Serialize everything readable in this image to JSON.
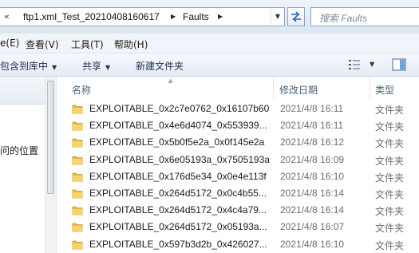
{
  "address_bar": {
    "overflow_chevron": "«",
    "crumbs": [
      "ftp1.xml_Test_20210408160617",
      "Faults"
    ]
  },
  "search": {
    "placeholder": "搜索 Faults"
  },
  "menu": {
    "items": [
      "e(E)",
      "查看(V)",
      "工具(T)",
      "帮助(H)"
    ]
  },
  "toolbar": {
    "include_in_library": "包含到库中",
    "share": "共享",
    "new_folder": "新建文件夹"
  },
  "nav_pane": {
    "visible_text": "问的位置"
  },
  "columns": {
    "name": "名称",
    "date": "修改日期",
    "type": "类型"
  },
  "files": [
    {
      "name": "EXPLOITABLE_0x2c7e0762_0x16107b60",
      "date": "2021/4/8 16:11",
      "type": "文件夹"
    },
    {
      "name": "EXPLOITABLE_0x4e6d4074_0x553939...",
      "date": "2021/4/8 16:11",
      "type": "文件夹"
    },
    {
      "name": "EXPLOITABLE_0x5b0f5e2a_0x0f145e2a",
      "date": "2021/4/8 16:12",
      "type": "文件夹"
    },
    {
      "name": "EXPLOITABLE_0x6e05193a_0x7505193a",
      "date": "2021/4/8 16:09",
      "type": "文件夹"
    },
    {
      "name": "EXPLOITABLE_0x176d5e34_0x0e4e113f",
      "date": "2021/4/8 16:10",
      "type": "文件夹"
    },
    {
      "name": "EXPLOITABLE_0x264d5172_0x0c4b55...",
      "date": "2021/4/8 16:14",
      "type": "文件夹"
    },
    {
      "name": "EXPLOITABLE_0x264d5172_0x4c4a79...",
      "date": "2021/4/8 16:14",
      "type": "文件夹"
    },
    {
      "name": "EXPLOITABLE_0x264d5172_0x05193a...",
      "date": "2021/4/8 16:07",
      "type": "文件夹"
    },
    {
      "name": "EXPLOITABLE_0x597b3d2b_0x426027...",
      "date": "2021/4/8 16:10",
      "type": "文件夹"
    }
  ]
}
